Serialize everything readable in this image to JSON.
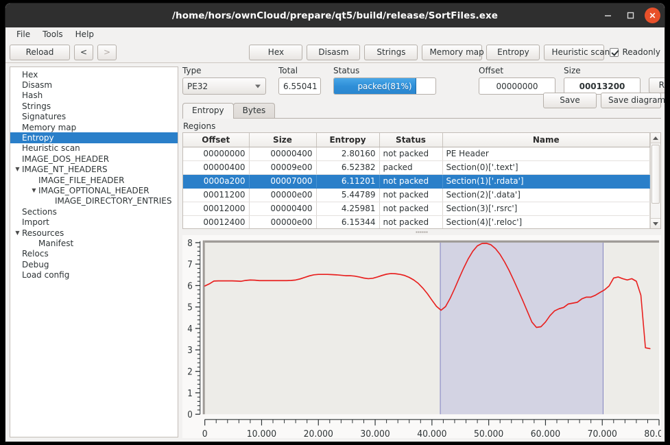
{
  "window": {
    "title": "/home/hors/ownCloud/prepare/qt5/build/release/SortFiles.exe",
    "minimize_icon": "minimize-icon",
    "maximize_icon": "maximize-icon",
    "close_icon": "close-icon"
  },
  "menubar": {
    "items": [
      {
        "label": "File"
      },
      {
        "label": "Tools"
      },
      {
        "label": "Help"
      }
    ]
  },
  "toolbar": {
    "reload_label": "Reload",
    "back_label": "<",
    "forward_label": ">",
    "buttons": [
      {
        "label": "Hex"
      },
      {
        "label": "Disasm"
      },
      {
        "label": "Strings"
      },
      {
        "label": "Memory map"
      },
      {
        "label": "Entropy"
      },
      {
        "label": "Heuristic scan"
      }
    ],
    "readonly_label": "Readonly",
    "readonly_checked": true
  },
  "sidebar": {
    "items": [
      {
        "label": "Hex",
        "indent": 0,
        "arrow": "",
        "selected": false
      },
      {
        "label": "Disasm",
        "indent": 0,
        "arrow": "",
        "selected": false
      },
      {
        "label": "Hash",
        "indent": 0,
        "arrow": "",
        "selected": false
      },
      {
        "label": "Strings",
        "indent": 0,
        "arrow": "",
        "selected": false
      },
      {
        "label": "Signatures",
        "indent": 0,
        "arrow": "",
        "selected": false
      },
      {
        "label": "Memory map",
        "indent": 0,
        "arrow": "",
        "selected": false
      },
      {
        "label": "Entropy",
        "indent": 0,
        "arrow": "",
        "selected": true
      },
      {
        "label": "Heuristic scan",
        "indent": 0,
        "arrow": "",
        "selected": false
      },
      {
        "label": "IMAGE_DOS_HEADER",
        "indent": 0,
        "arrow": "",
        "selected": false
      },
      {
        "label": "IMAGE_NT_HEADERS",
        "indent": 0,
        "arrow": "▼",
        "selected": false
      },
      {
        "label": "IMAGE_FILE_HEADER",
        "indent": 1,
        "arrow": "",
        "selected": false
      },
      {
        "label": "IMAGE_OPTIONAL_HEADER",
        "indent": 1,
        "arrow": "▼",
        "selected": false
      },
      {
        "label": "IMAGE_DIRECTORY_ENTRIES",
        "indent": 2,
        "arrow": "",
        "selected": false
      },
      {
        "label": "Sections",
        "indent": 0,
        "arrow": "",
        "selected": false
      },
      {
        "label": "Import",
        "indent": 0,
        "arrow": "",
        "selected": false
      },
      {
        "label": "Resources",
        "indent": 0,
        "arrow": "▼",
        "selected": false
      },
      {
        "label": "Manifest",
        "indent": 1,
        "arrow": "",
        "selected": false
      },
      {
        "label": "Relocs",
        "indent": 0,
        "arrow": "",
        "selected": false
      },
      {
        "label": "Debug",
        "indent": 0,
        "arrow": "",
        "selected": false
      },
      {
        "label": "Load config",
        "indent": 0,
        "arrow": "",
        "selected": false
      }
    ]
  },
  "form": {
    "type_label": "Type",
    "type_value": "PE32",
    "total_label": "Total",
    "total_value": "6.55041",
    "status_label": "Status",
    "status_value": "packed(81%)",
    "status_percent": 81,
    "offset_label": "Offset",
    "offset_value": "00000000",
    "size_label": "Size",
    "size_value": "00013200",
    "reload_label": "Reload",
    "save_label": "Save",
    "save_diagram_label": "Save diagram"
  },
  "tabs": [
    {
      "label": "Entropy",
      "active": true
    },
    {
      "label": "Bytes",
      "active": false
    }
  ],
  "regions": {
    "group_label": "Regions",
    "columns": [
      "Offset",
      "Size",
      "Entropy",
      "Status",
      "Name"
    ],
    "rows": [
      {
        "offset": "00000000",
        "size": "00000400",
        "entropy": "2.80160",
        "status": "not packed",
        "name": "PE Header",
        "selected": false
      },
      {
        "offset": "00000400",
        "size": "00009e00",
        "entropy": "6.52382",
        "status": "packed",
        "name": "Section(0)['.text']",
        "selected": false
      },
      {
        "offset": "0000a200",
        "size": "00007000",
        "entropy": "6.11201",
        "status": "not packed",
        "name": "Section(1)['.rdata']",
        "selected": true
      },
      {
        "offset": "00011200",
        "size": "00000e00",
        "entropy": "5.44789",
        "status": "not packed",
        "name": "Section(2)['.data']",
        "selected": false
      },
      {
        "offset": "00012000",
        "size": "00000400",
        "entropy": "4.25981",
        "status": "not packed",
        "name": "Section(3)['.rsrc']",
        "selected": false
      },
      {
        "offset": "00012400",
        "size": "00000e00",
        "entropy": "6.15344",
        "status": "not packed",
        "name": "Section(4)['.reloc']",
        "selected": false
      }
    ]
  },
  "colors": {
    "accent": "#2a7fc9",
    "curve": "#e8201f",
    "close_button": "#e8502a",
    "chart_bg": "#edece8",
    "highlight_band": "#d3d3e3",
    "band_edge": "#7f7fbf"
  },
  "chart_data": {
    "type": "line",
    "title": "",
    "xlabel": "",
    "ylabel": "",
    "xlim": [
      0,
      80000
    ],
    "ylim": [
      0,
      8
    ],
    "grid": false,
    "legend": "none",
    "xticks": [
      0,
      10000,
      20000,
      30000,
      40000,
      50000,
      60000,
      70000,
      80000
    ],
    "xticklabels": [
      "0",
      "10.000",
      "20.000",
      "30.000",
      "40.000",
      "50.000",
      "60.000",
      "70.000",
      "80.000"
    ],
    "yticks": [
      0,
      1,
      2,
      3,
      4,
      5,
      6,
      7,
      8
    ],
    "yticklabels": [
      "0",
      "1",
      "2",
      "3",
      "4",
      "5",
      "6",
      "7",
      "8"
    ],
    "highlight_region": {
      "start": 41472,
      "end": 70144,
      "label": "Section(1)['.rdata']"
    },
    "series": [
      {
        "name": "entropy",
        "color": "#e8201f",
        "x": [
          0,
          800,
          1600,
          2400,
          3200,
          4000,
          4800,
          5600,
          6400,
          7200,
          8000,
          8800,
          9600,
          10400,
          11200,
          12000,
          12800,
          13600,
          14400,
          15200,
          16000,
          16800,
          17600,
          18400,
          19200,
          20000,
          20800,
          21600,
          22400,
          23200,
          24000,
          24800,
          25600,
          26400,
          27200,
          28000,
          28800,
          29600,
          30400,
          31200,
          32000,
          32800,
          33600,
          34400,
          35200,
          36000,
          36800,
          37600,
          38400,
          39200,
          40000,
          40800,
          41600,
          42400,
          43200,
          44000,
          44800,
          45600,
          46400,
          47200,
          48000,
          48800,
          49600,
          50400,
          51200,
          52000,
          52800,
          53600,
          54400,
          55200,
          56000,
          56800,
          57600,
          58400,
          59200,
          60000,
          60800,
          61600,
          62400,
          63200,
          64000,
          64800,
          65600,
          66400,
          67200,
          68000,
          68800,
          69600,
          70400,
          71200,
          72000,
          72800,
          73600,
          74400,
          75200,
          76000,
          76800,
          77600,
          78400
        ],
        "y": [
          5.98,
          6.08,
          6.21,
          6.22,
          6.22,
          6.22,
          6.22,
          6.21,
          6.2,
          6.24,
          6.26,
          6.25,
          6.23,
          6.23,
          6.23,
          6.23,
          6.23,
          6.23,
          6.23,
          6.24,
          6.26,
          6.31,
          6.38,
          6.45,
          6.5,
          6.52,
          6.52,
          6.52,
          6.51,
          6.5,
          6.48,
          6.46,
          6.46,
          6.44,
          6.4,
          6.35,
          6.32,
          6.34,
          6.4,
          6.47,
          6.53,
          6.56,
          6.55,
          6.52,
          6.47,
          6.38,
          6.26,
          6.1,
          5.88,
          5.62,
          5.32,
          5.03,
          4.85,
          5.02,
          5.4,
          5.86,
          6.35,
          6.82,
          7.25,
          7.6,
          7.85,
          7.96,
          7.97,
          7.9,
          7.72,
          7.45,
          7.1,
          6.7,
          6.25,
          5.78,
          5.3,
          4.8,
          4.3,
          4.05,
          4.08,
          4.3,
          4.6,
          4.82,
          4.92,
          4.98,
          5.14,
          5.18,
          5.22,
          5.38,
          5.46,
          5.46,
          5.55,
          5.68,
          5.8,
          5.98,
          6.35,
          6.4,
          6.32,
          6.26,
          6.32,
          6.2,
          5.55,
          3.1,
          3.06
        ]
      }
    ]
  }
}
